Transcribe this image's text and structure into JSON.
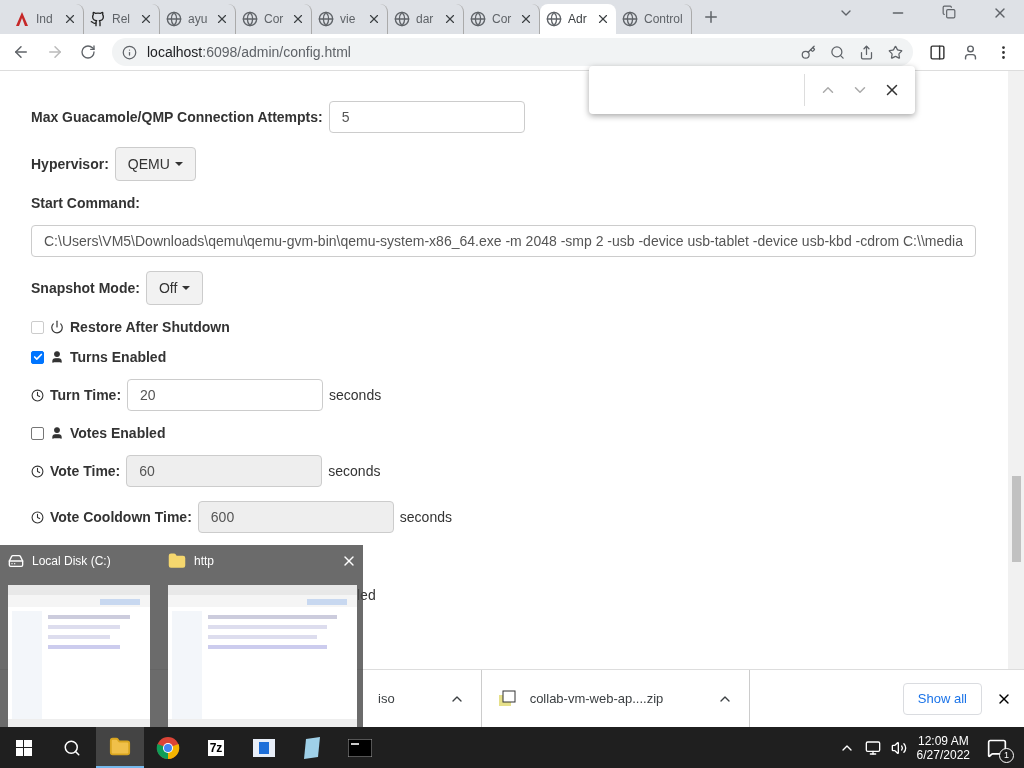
{
  "browser": {
    "tabs": [
      {
        "kind": "arrow",
        "title": "Ind",
        "selected": false
      },
      {
        "kind": "github",
        "title": "Rel",
        "selected": false
      },
      {
        "kind": "globe",
        "title": "ayu",
        "selected": false
      },
      {
        "kind": "globe",
        "title": "Cor",
        "selected": false
      },
      {
        "kind": "globe",
        "title": "vie",
        "selected": false
      },
      {
        "kind": "globe",
        "title": "dar",
        "selected": false
      },
      {
        "kind": "globe",
        "title": "Cor",
        "selected": false
      },
      {
        "kind": "globe",
        "title": "Adr",
        "selected": true
      },
      {
        "kind": "globe",
        "title": "Control",
        "selected": false
      }
    ],
    "address": {
      "host": "localhost",
      "path": ":6098/admin/config.html"
    }
  },
  "form": [
    {
      "kind": "input",
      "label": "Max Guacamole/QMP Connection Attempts:",
      "value": "5"
    },
    {
      "kind": "dropdown",
      "label": "Hypervisor:",
      "value": "QEMU"
    },
    {
      "kind": "heading",
      "label": "Start Command:"
    },
    {
      "kind": "wide",
      "value": "C:\\Users\\VM5\\Downloads\\qemu\\qemu-gvm-bin\\qemu-system-x86_64.exe -m 2048 -smp 2 -usb -device usb-tablet -device usb-kbd -cdrom C:\\\\media"
    },
    {
      "kind": "dropdown",
      "label": "Snapshot Mode:",
      "value": "Off"
    },
    {
      "kind": "power",
      "label": "Restore After Shutdown",
      "checked": false,
      "disabled": true
    },
    {
      "kind": "user",
      "label": "Turns Enabled",
      "checked": true,
      "disabled": false
    },
    {
      "kind": "timed",
      "label": "Turn Time:",
      "value": "20",
      "unit": "seconds",
      "disabled": false
    },
    {
      "kind": "user",
      "label": "Votes Enabled",
      "checked": false,
      "disabled": false
    },
    {
      "kind": "timed",
      "label": "Vote Time:",
      "value": "60",
      "unit": "seconds",
      "disabled": true
    },
    {
      "kind": "timed",
      "label": "Vote Cooldown Time:",
      "value": "600",
      "unit": "seconds",
      "disabled": true
    },
    {
      "kind": "fragment",
      "label": "led"
    }
  ],
  "downloads": {
    "items": [
      {
        "kind": "hidden-icon",
        "name": "iso"
      },
      {
        "kind": "zip",
        "name": "collab-vm-web-ap....zip"
      }
    ],
    "show_all": "Show all"
  },
  "taskbar_preview": {
    "windows": [
      {
        "kind": "drive",
        "title": "Local Disk (C:)"
      },
      {
        "kind": "folder",
        "title": "http"
      }
    ]
  },
  "taskbar": {
    "apps": [
      {
        "kind": "explorer",
        "selected": true
      },
      {
        "kind": "chrome",
        "selected": false
      },
      {
        "kind": "sevenzip",
        "label": "7z",
        "selected": false
      },
      {
        "kind": "window",
        "selected": false
      },
      {
        "kind": "notepad",
        "selected": false
      },
      {
        "kind": "console",
        "selected": false
      }
    ],
    "time": "12:09 AM",
    "date": "6/27/2022",
    "notifications": "1"
  }
}
